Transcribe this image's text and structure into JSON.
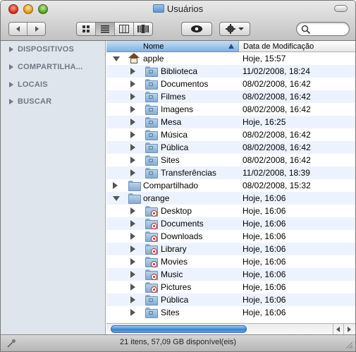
{
  "window": {
    "title": "Usuários"
  },
  "toolbar": {
    "back_icon": "chevron-left-icon",
    "forward_icon": "chevron-right-icon",
    "view_icons": [
      "grid-view-icon",
      "list-view-icon",
      "column-view-icon",
      "coverflow-view-icon"
    ],
    "active_view": "list",
    "quicklook_icon": "eye-icon",
    "action_icon": "gear-icon",
    "search_placeholder": ""
  },
  "sidebar": {
    "items": [
      {
        "label": "DISPOSITIVOS"
      },
      {
        "label": "COMPARTILHA..."
      },
      {
        "label": "LOCAIS"
      },
      {
        "label": "BUSCAR"
      }
    ]
  },
  "columns": {
    "name": "Nome",
    "date": "Data de Modificação"
  },
  "rows": [
    {
      "name": "apple",
      "date": "Hoje, 15:57",
      "level": 0,
      "expanded": true,
      "icon": "home-folder-icon"
    },
    {
      "name": "Biblioteca",
      "date": "11/02/2008, 18:24",
      "level": 1,
      "icon": "library-folder-icon"
    },
    {
      "name": "Documentos",
      "date": "08/02/2008, 16:42",
      "level": 1,
      "icon": "documents-folder-icon"
    },
    {
      "name": "Filmes",
      "date": "08/02/2008, 16:42",
      "level": 1,
      "icon": "movies-folder-icon"
    },
    {
      "name": "Imagens",
      "date": "08/02/2008, 16:42",
      "level": 1,
      "icon": "pictures-folder-icon"
    },
    {
      "name": "Mesa",
      "date": "Hoje, 16:25",
      "level": 1,
      "icon": "desktop-folder-icon"
    },
    {
      "name": "Música",
      "date": "08/02/2008, 16:42",
      "level": 1,
      "icon": "music-folder-icon"
    },
    {
      "name": "Pública",
      "date": "08/02/2008, 16:42",
      "level": 1,
      "icon": "public-folder-icon"
    },
    {
      "name": "Sites",
      "date": "08/02/2008, 16:42",
      "level": 1,
      "icon": "sites-folder-icon"
    },
    {
      "name": "Transferências",
      "date": "11/02/2008, 18:39",
      "level": 1,
      "icon": "downloads-folder-icon"
    },
    {
      "name": "Compartilhado",
      "date": "08/02/2008, 15:32",
      "level": 0,
      "expanded": false,
      "icon": "folder-icon"
    },
    {
      "name": "orange",
      "date": "Hoje, 16:06",
      "level": 0,
      "expanded": true,
      "icon": "folder-icon"
    },
    {
      "name": "Desktop",
      "date": "Hoje, 16:06",
      "level": 1,
      "icon": "restricted-folder-icon"
    },
    {
      "name": "Documents",
      "date": "Hoje, 16:06",
      "level": 1,
      "icon": "restricted-folder-icon"
    },
    {
      "name": "Downloads",
      "date": "Hoje, 16:06",
      "level": 1,
      "icon": "restricted-folder-icon"
    },
    {
      "name": "Library",
      "date": "Hoje, 16:06",
      "level": 1,
      "icon": "restricted-folder-icon"
    },
    {
      "name": "Movies",
      "date": "Hoje, 16:06",
      "level": 1,
      "icon": "restricted-folder-icon"
    },
    {
      "name": "Music",
      "date": "Hoje, 16:06",
      "level": 1,
      "icon": "restricted-folder-icon"
    },
    {
      "name": "Pictures",
      "date": "Hoje, 16:06",
      "level": 1,
      "icon": "restricted-folder-icon"
    },
    {
      "name": "Pública",
      "date": "Hoje, 16:06",
      "level": 1,
      "icon": "public-folder-icon"
    },
    {
      "name": "Sites",
      "date": "Hoje, 16:06",
      "level": 1,
      "icon": "sites-folder-icon"
    }
  ],
  "status": {
    "text": "21 itens, 57,09 GB disponível(eis)"
  },
  "colors": {
    "header_selected": "#7fb1e3",
    "row_alt": "#edf3fe",
    "sidebar_bg": "#dfe5ec"
  }
}
